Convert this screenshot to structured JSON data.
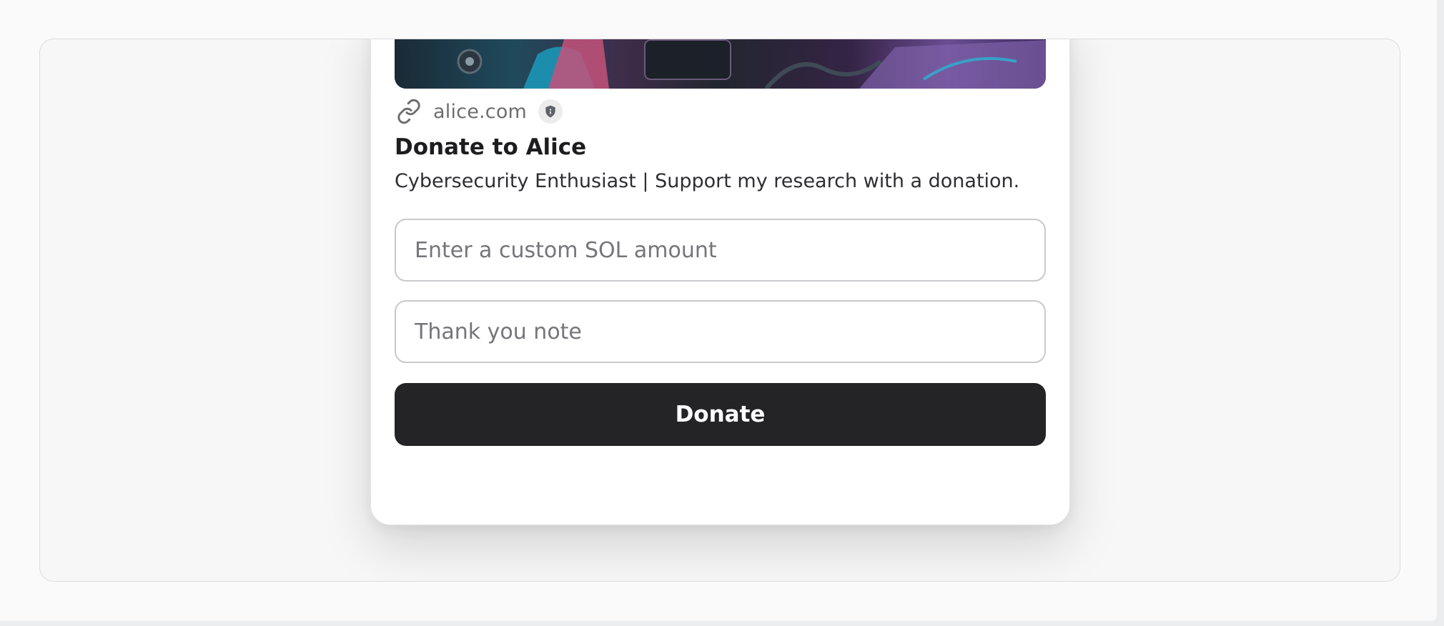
{
  "card": {
    "banner_image": "cyberpunk-artwork-image",
    "domain": "alice.com",
    "domain_icon": "link-icon",
    "verified_icon": "shield-icon",
    "title": "Donate to Alice",
    "description": "Cybersecurity Enthusiast | Support my research with a donation.",
    "amount_input": {
      "value": "",
      "placeholder": "Enter a custom SOL amount"
    },
    "note_input": {
      "value": "",
      "placeholder": "Thank you note"
    },
    "donate_label": "Donate"
  },
  "colors": {
    "button_bg": "#242426",
    "page_bg": "#fafafa",
    "panel_bg": "#f7f7f8"
  }
}
